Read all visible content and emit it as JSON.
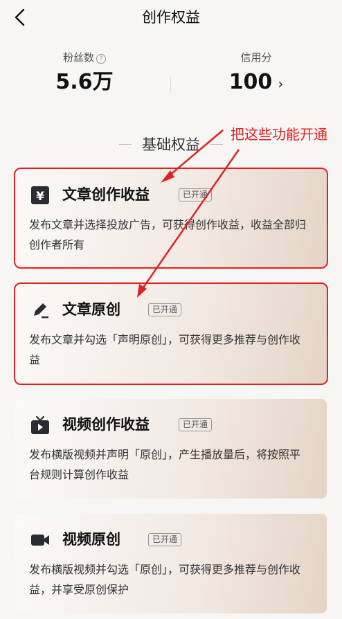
{
  "nav": {
    "title": "创作权益"
  },
  "stats": {
    "fans_label": "粉丝数",
    "fans_value": "5.6万",
    "credit_label": "信用分",
    "credit_value": "100"
  },
  "section": {
    "title": "基础权益"
  },
  "annotation": {
    "text": "把这些功能开通"
  },
  "cards": [
    {
      "title": "文章创作收益",
      "badge": "已开通",
      "desc": "发布文章并选择投放广告，可获得创作收益，收益全部归创作者所有",
      "icon": "yen-icon"
    },
    {
      "title": "文章原创",
      "badge": "已开通",
      "desc": "发布文章并勾选「声明原创」，可获得更多推荐与创作收益",
      "icon": "pen-icon"
    },
    {
      "title": "视频创作收益",
      "badge": "已开通",
      "desc": "发布横版视频并声明「原创」，产生播放量后，将按照平台规则计算创作收益",
      "icon": "tv-icon"
    },
    {
      "title": "视频原创",
      "badge": "已开通",
      "desc": "发布横版视频并勾选「原创」，可获得更多推荐与创作收益，并享受原创保护",
      "icon": "video-camera-icon"
    }
  ],
  "colors": {
    "annotation": "#e22020",
    "card_gradient_end": "#e4d4c6"
  }
}
